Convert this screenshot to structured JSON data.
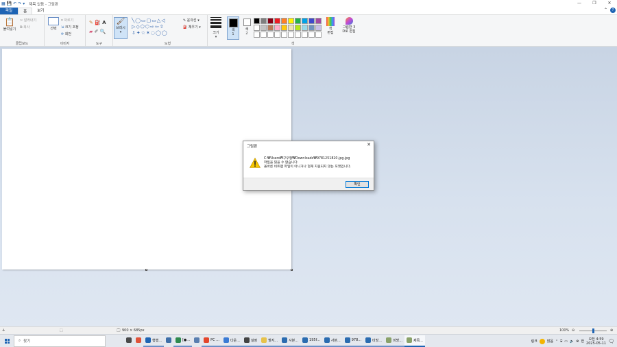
{
  "window": {
    "title": "제목 없음 - 그림판",
    "controls": {
      "minimize": "—",
      "restore": "❐",
      "close": "✕"
    }
  },
  "tabs": [
    {
      "label": "파일"
    },
    {
      "label": "홈"
    },
    {
      "label": "보기"
    }
  ],
  "ribbon": {
    "clipboard": {
      "paste": "붙여넣기",
      "cut": "잘라내기",
      "copy": "복사",
      "label": "클립보드"
    },
    "image": {
      "select": "선택",
      "crop": "자르기",
      "resize": "크기 조정",
      "rotate": "회전",
      "label": "이미지"
    },
    "tools": {
      "label": "도구"
    },
    "brushes": {
      "label": "브러시"
    },
    "shapes": {
      "outline": "윤곽선",
      "fill": "채우기",
      "label": "도형"
    },
    "size": {
      "label": "크기"
    },
    "colors": {
      "color1": "색\n1",
      "color2": "색\n2",
      "edit": "색\n편집",
      "paint3d": "그림판 3\nD로 편집",
      "label": "색",
      "palette": [
        "#000000",
        "#7f7f7f",
        "#880015",
        "#ed1c24",
        "#ff7f27",
        "#fff200",
        "#22b14c",
        "#00a2e8",
        "#3f48cc",
        "#a349a4",
        "#ffffff",
        "#c3c3c3",
        "#b97a57",
        "#ffaec9",
        "#ffc90e",
        "#efe4b0",
        "#b5e61d",
        "#99d9ea",
        "#7092be",
        "#c8bfe7",
        "#ffffff",
        "#ffffff",
        "#ffffff",
        "#ffffff",
        "#ffffff",
        "#ffffff",
        "#ffffff",
        "#ffffff",
        "#ffffff",
        "#ffffff"
      ]
    }
  },
  "status": {
    "dimensions": "900 × 685px",
    "zoom": "100%"
  },
  "dialog": {
    "title": "그림판",
    "path": "C:₩Users₩구우형₩Downloads₩9781251820.jpg.jpg",
    "line1": "파일을 읽을 수 없습니다.",
    "line2": "올바른 비트맵 파일이 아니거나 현재 지원되지 않는 포맷입니다.",
    "ok": "확인"
  },
  "taskbar": {
    "search": "찾기",
    "tasks": [
      {
        "label": "",
        "color": "#4a4a4a"
      },
      {
        "label": "",
        "color": "#e0533a"
      },
      {
        "label": "행행...",
        "color": "#1e64b4"
      },
      {
        "label": "",
        "color": "#3f6fa8"
      },
      {
        "label": "[●...",
        "color": "#2f8a4f"
      },
      {
        "label": "",
        "color": "#5a7fb0"
      },
      {
        "label": "PC ...",
        "color": "#e4462c"
      },
      {
        "label": "다운...",
        "color": "#3a7bd5"
      },
      {
        "label": "설정",
        "color": "#444444"
      },
      {
        "label": "할지...",
        "color": "#e7c24a"
      },
      {
        "label": "사본...",
        "color": "#2b6cb0"
      },
      {
        "label": "195f...",
        "color": "#2b6cb0"
      },
      {
        "label": "사본...",
        "color": "#2b6cb0"
      },
      {
        "label": "978...",
        "color": "#2b6cb0"
      },
      {
        "label": "미방...",
        "color": "#2b6cb0"
      },
      {
        "label": "미방...",
        "color": "#8aa26a"
      },
      {
        "label": "제목...",
        "color": "#8aa26a"
      }
    ],
    "weather": "맑음",
    "time": "오전 4:59",
    "date": "2025-05-11",
    "language": "링크"
  }
}
